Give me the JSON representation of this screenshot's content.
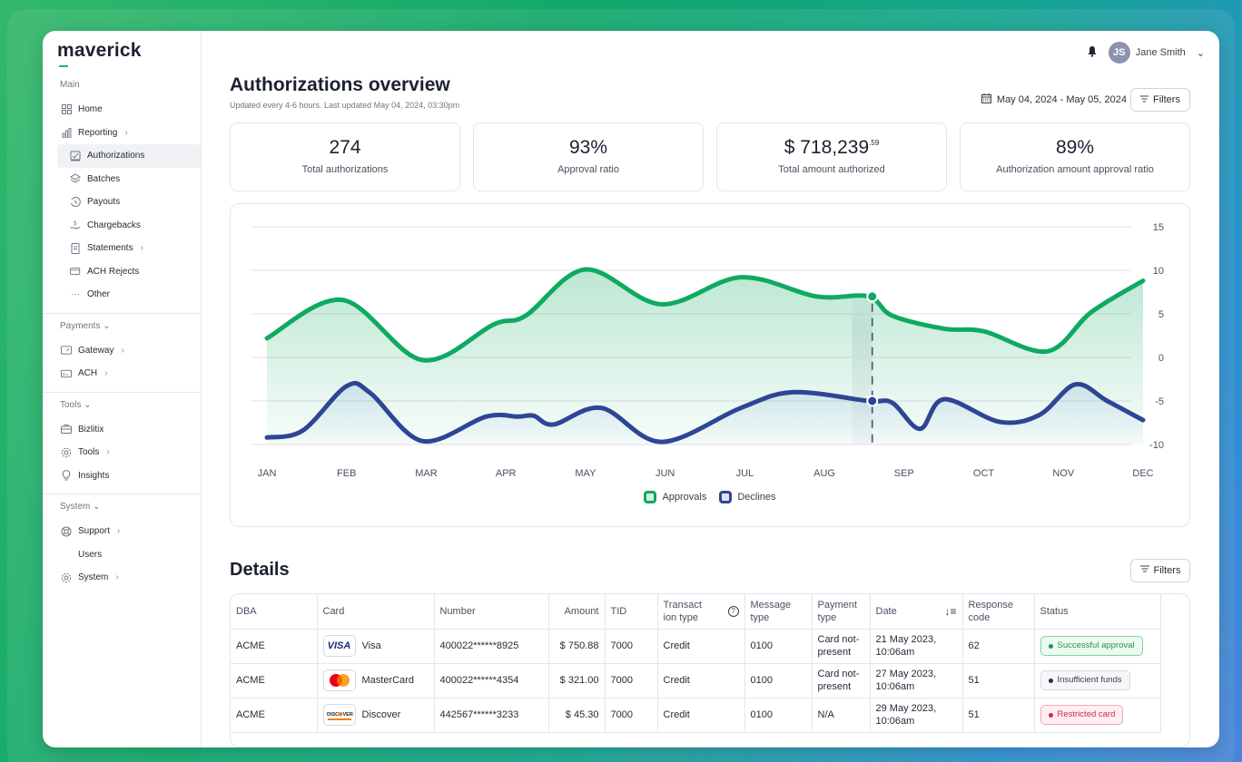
{
  "app": {
    "logo": "maverick"
  },
  "user": {
    "initials": "JS",
    "name": "Jane Smith"
  },
  "sidebar": {
    "main_label": "Main",
    "items_main": [
      {
        "label": "Home",
        "icon": "grid-icon"
      },
      {
        "label": "Reporting",
        "icon": "bar-chart-icon"
      },
      {
        "label": "Authorizations",
        "icon": "receipt-icon"
      },
      {
        "label": "Batches",
        "icon": "layers-icon"
      },
      {
        "label": "Payouts",
        "icon": "history-icon"
      },
      {
        "label": "Chargebacks",
        "icon": "hand-coin-icon"
      },
      {
        "label": "Statements",
        "icon": "document-icon"
      },
      {
        "label": "ACH Rejects",
        "icon": "card-reject-icon"
      },
      {
        "label": "Other",
        "icon": "ellipsis-icon"
      }
    ],
    "payments_label": "Payments",
    "items_payments": [
      {
        "label": "Gateway",
        "icon": "gateway-icon"
      },
      {
        "label": "ACH",
        "icon": "ach-icon"
      }
    ],
    "tools_label": "Tools",
    "items_tools": [
      {
        "label": "Bizlitix",
        "icon": "briefcase-icon"
      },
      {
        "label": "Tools",
        "icon": "cog-icon"
      },
      {
        "label": "Insights",
        "icon": "lightbulb-icon"
      }
    ],
    "system_label": "System",
    "items_system": [
      {
        "label": "Support",
        "icon": "lifebuoy-icon"
      },
      {
        "label": "Users",
        "icon": ""
      },
      {
        "label": "System",
        "icon": "cog-icon"
      }
    ]
  },
  "header": {
    "title": "Authorizations overview",
    "subtitle": "Updated every 4-6 hours. Last updated May 04, 2024, 03:30pm",
    "date_range": "May 04, 2024 - May 05, 2024",
    "filters_label": "Filters"
  },
  "kpis": [
    {
      "value": "274",
      "sup": "",
      "label": "Total authorizations"
    },
    {
      "value": "93%",
      "sup": "",
      "label": "Approval ratio"
    },
    {
      "value": "$ 718,239",
      "sup": ".59",
      "label": "Total amount authorized"
    },
    {
      "value": "89%",
      "sup": "",
      "label": "Authorization amount approval ratio"
    }
  ],
  "chart_data": {
    "type": "area",
    "categories": [
      "JAN",
      "FEB",
      "MAR",
      "APR",
      "MAY",
      "JUN",
      "JUL",
      "AUG",
      "SEP",
      "OCT",
      "NOV",
      "DEC"
    ],
    "y_ticks": [
      15,
      10,
      5,
      0,
      -5,
      -10
    ],
    "ylim": [
      -10,
      15
    ],
    "series": [
      {
        "name": "Approvals",
        "color": "#0faa62",
        "points": [
          [
            0,
            2.2
          ],
          [
            0.95,
            6.6
          ],
          [
            1.95,
            -0.3
          ],
          [
            2.85,
            3.8
          ],
          [
            3.25,
            4.8
          ],
          [
            4.0,
            10.1
          ],
          [
            4.95,
            6.1
          ],
          [
            5.95,
            9.2
          ],
          [
            6.9,
            7.0
          ],
          [
            7.55,
            7.0
          ],
          [
            7.85,
            4.8
          ],
          [
            8.5,
            3.3
          ],
          [
            9.0,
            3.0
          ],
          [
            9.8,
            0.7
          ],
          [
            10.35,
            5.2
          ],
          [
            11,
            8.8
          ]
        ]
      },
      {
        "name": "Declines",
        "color": "#2e4595",
        "points": [
          [
            0,
            -9.2
          ],
          [
            0.45,
            -8.4
          ],
          [
            1.0,
            -3.3
          ],
          [
            1.3,
            -4.1
          ],
          [
            1.95,
            -9.6
          ],
          [
            2.75,
            -6.8
          ],
          [
            3.15,
            -6.8
          ],
          [
            3.35,
            -6.7
          ],
          [
            3.6,
            -7.7
          ],
          [
            4.2,
            -5.8
          ],
          [
            4.95,
            -9.7
          ],
          [
            5.95,
            -5.8
          ],
          [
            6.6,
            -4.0
          ],
          [
            7.55,
            -5.0
          ],
          [
            7.85,
            -5.2
          ],
          [
            8.2,
            -8.2
          ],
          [
            8.5,
            -4.8
          ],
          [
            9.2,
            -7.4
          ],
          [
            9.7,
            -6.6
          ],
          [
            10.15,
            -3.1
          ],
          [
            10.55,
            -5.0
          ],
          [
            11,
            -7.2
          ]
        ]
      }
    ],
    "cursor_x": 7.6,
    "legend": [
      "Approvals",
      "Declines"
    ]
  },
  "details": {
    "title": "Details",
    "filters_label": "Filters",
    "columns": [
      "DBA",
      "Card",
      "Number",
      "Amount",
      "TID",
      "Transact ion type",
      "Message type",
      "Payment type",
      "Date",
      "Response code",
      "Status"
    ],
    "rows": [
      {
        "dba": "ACME",
        "card": "Visa",
        "card_logo": "visa-logo",
        "number": "400022******8925",
        "amount": "$ 750.88",
        "tid": "7000",
        "txn_type": "Credit",
        "msg_type": "0100",
        "pay_type": "Card not-present",
        "date": "21 May 2023, 10:06am",
        "resp": "62",
        "status": "Successful approval",
        "status_color": "#1a9a4f"
      },
      {
        "dba": "ACME",
        "card": "MasterCard",
        "card_logo": "mastercard-logo",
        "number": "400022******4354",
        "amount": "$ 321.00",
        "tid": "7000",
        "txn_type": "Credit",
        "msg_type": "0100",
        "pay_type": "Card not-present",
        "date": "27 May 2023, 10:06am",
        "resp": "51",
        "status": "Insufficient funds",
        "status_color": "#3a3f4c"
      },
      {
        "dba": "ACME",
        "card": "Discover",
        "card_logo": "discover-logo",
        "number": "442567******3233",
        "amount": "$ 45.30",
        "tid": "7000",
        "txn_type": "Credit",
        "msg_type": "0100",
        "pay_type": "N/A",
        "date": "29 May 2023, 10:06am",
        "resp": "51",
        "status": "Restricted card",
        "status_color": "#d02b45"
      }
    ]
  }
}
